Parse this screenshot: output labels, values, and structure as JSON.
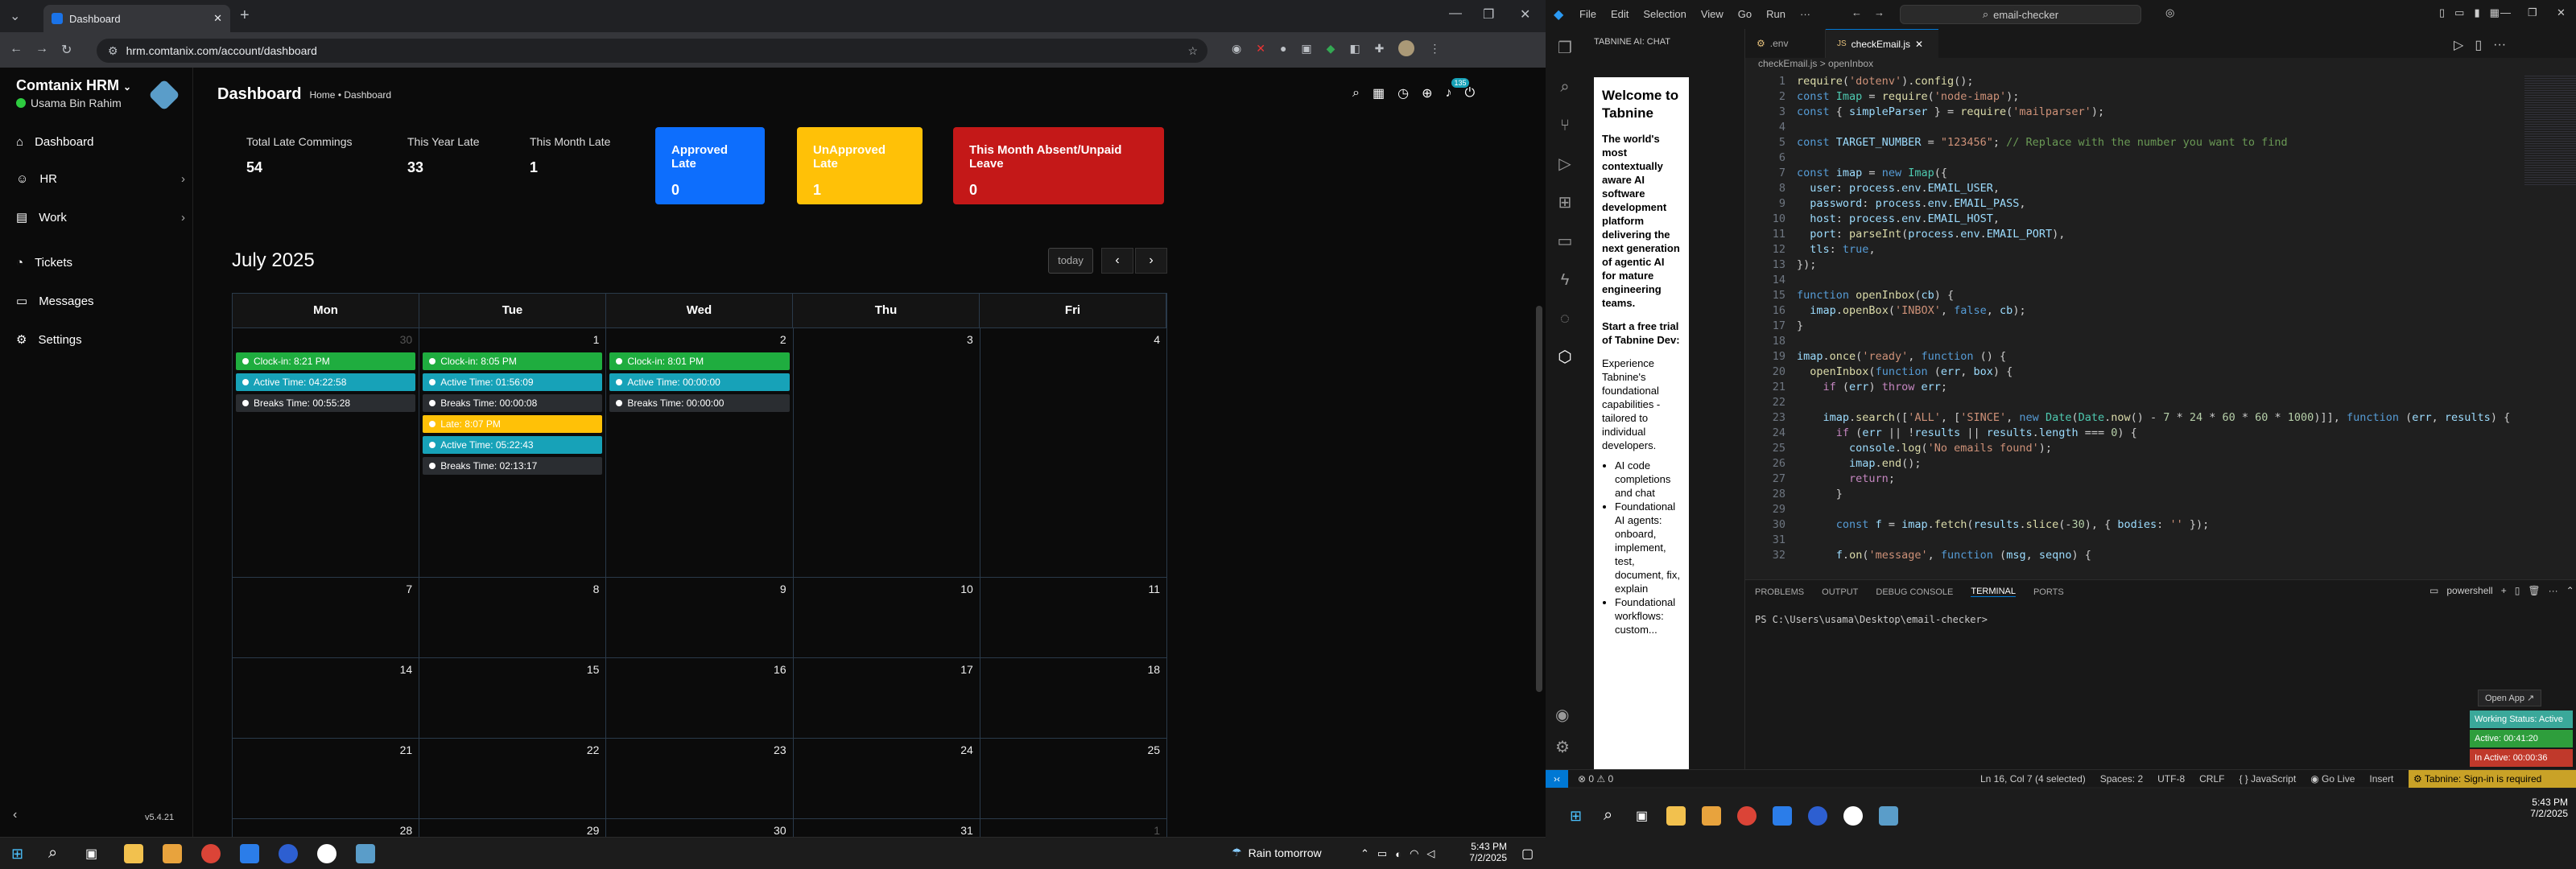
{
  "browser": {
    "tab_title": "Dashboard",
    "url": "hrm.comtanix.com/account/dashboard"
  },
  "app": {
    "brand": "Comtanix HRM",
    "user": "Usama Bin Rahim",
    "version": "v5.4.21",
    "page_title": "Dashboard",
    "breadcrumb": "Home • Dashboard",
    "notif_count": "135",
    "sidebar": [
      {
        "label": "Dashboard",
        "icon": "home-icon"
      },
      {
        "label": "HR",
        "icon": "people-icon"
      },
      {
        "label": "Work",
        "icon": "briefcase-icon"
      },
      {
        "label": "Tickets",
        "icon": "ticket-icon"
      },
      {
        "label": "Messages",
        "icon": "chat-icon"
      },
      {
        "label": "Settings",
        "icon": "gear-icon"
      }
    ],
    "stats": [
      {
        "label": "Total Late Commings",
        "value": "54"
      },
      {
        "label": "This Year Late",
        "value": "33"
      },
      {
        "label": "This Month Late",
        "value": "1"
      }
    ],
    "cards": [
      {
        "label": "Approved Late",
        "value": "0",
        "color": "#0d6efd"
      },
      {
        "label": "UnApproved Late",
        "value": "1",
        "color": "#ffc107"
      },
      {
        "label": "This Month Absent/Unpaid Leave",
        "value": "0",
        "color": "#c41818"
      }
    ],
    "calendar": {
      "month": "July 2025",
      "today_btn": "today",
      "days": [
        "Mon",
        "Tue",
        "Wed",
        "Thu",
        "Fri"
      ],
      "weeks": [
        [
          "30",
          "1",
          "2",
          "3",
          "4"
        ],
        [
          "7",
          "8",
          "9",
          "10",
          "11"
        ],
        [
          "14",
          "15",
          "16",
          "17",
          "18"
        ],
        [
          "21",
          "22",
          "23",
          "24",
          "25"
        ],
        [
          "28",
          "29",
          "30",
          "31",
          "1"
        ]
      ],
      "events": {
        "mon": [
          "Clock-in: 8:21 PM",
          "Active Time: 04:22:58",
          "Breaks Time: 00:55:28"
        ],
        "tue": [
          "Clock-in: 8:05 PM",
          "Active Time: 01:56:09",
          "Breaks Time: 00:00:08",
          "Late: 8:07 PM",
          "Active Time: 05:22:43",
          "Breaks Time: 02:13:17"
        ],
        "wed": [
          "Clock-in: 8:01 PM",
          "Active Time: 00:00:00",
          "Breaks Time: 00:00:00"
        ]
      }
    }
  },
  "windows_taskbar": {
    "weather": "Rain tomorrow",
    "time": "5:43 PM",
    "date": "7/2/2025"
  },
  "vscode": {
    "menu": [
      "File",
      "Edit",
      "Selection",
      "View",
      "Go",
      "Run"
    ],
    "search": "email-checker",
    "side_title": "TABNINE AI: CHAT",
    "tabnine": {
      "heading": "Welcome to Tabnine",
      "intro": "The world's most contextually aware AI software development platform delivering the next generation of agentic AI for mature engineering teams.",
      "trial": "Start a free trial of Tabnine Dev:",
      "desc": "Experience Tabnine's foundational capabilities - tailored to individual developers.",
      "bullets": [
        "AI code completions and chat",
        "Foundational AI agents: onboard, implement, test, document, fix, explain",
        "Foundational workflows: custom..."
      ]
    },
    "tabs": [
      ".env",
      "checkEmail.js"
    ],
    "breadcrumb": "checkEmail.js > openInbox",
    "code_lines": [
      "require('dotenv').config();",
      "const Imap = require('node-imap');",
      "const { simpleParser } = require('mailparser');",
      "",
      "const TARGET_NUMBER = \"123456\"; // Replace with the number you want to find",
      "",
      "const imap = new Imap({",
      "  user: process.env.EMAIL_USER,",
      "  password: process.env.EMAIL_PASS,",
      "  host: process.env.EMAIL_HOST,",
      "  port: parseInt(process.env.EMAIL_PORT),",
      "  tls: true,",
      "});",
      "",
      "function openInbox(cb) {",
      "  imap.openBox('INBOX', false, cb);",
      "}",
      "",
      "imap.once('ready', function () {",
      "  openInbox(function (err, box) {",
      "    if (err) throw err;",
      "",
      "    imap.search(['ALL', ['SINCE', new Date(Date.now() - 7 * 24 * 60 * 60 * 1000)]], function (err, results) {",
      "      if (err || !results || results.length === 0) {",
      "        console.log('No emails found');",
      "        imap.end();",
      "        return;",
      "      }",
      "",
      "      const f = imap.fetch(results.slice(-30), { bodies: '' });",
      "",
      "      f.on('message', function (msg, seqno) {"
    ],
    "panel_tabs": [
      "PROBLEMS",
      "OUTPUT",
      "DEBUG CONSOLE",
      "TERMINAL",
      "PORTS"
    ],
    "terminal_shell": "powershell",
    "prompt": "PS C:\\Users\\usama\\Desktop\\email-checker>",
    "open_app": "Open App ↗",
    "working": [
      {
        "label": "Working Status: Active",
        "color": "#3aa89a"
      },
      {
        "label": "Active: 00:41:20",
        "color": "#2e9e3c"
      },
      {
        "label": "In Active: 00:00:36",
        "color": "#c0392b"
      }
    ],
    "status": {
      "errors": "⊗ 0 ⚠ 0",
      "position": "Ln 16, Col 7 (4 selected)",
      "spaces": "Spaces: 2",
      "encoding": "UTF-8",
      "eol": "CRLF",
      "lang": "{ } JavaScript",
      "golive": "Go Live",
      "insert": "Insert",
      "tabnine": "Tabnine: Sign-in is required"
    },
    "time": "5:43 PM",
    "date": "7/2/2025"
  }
}
